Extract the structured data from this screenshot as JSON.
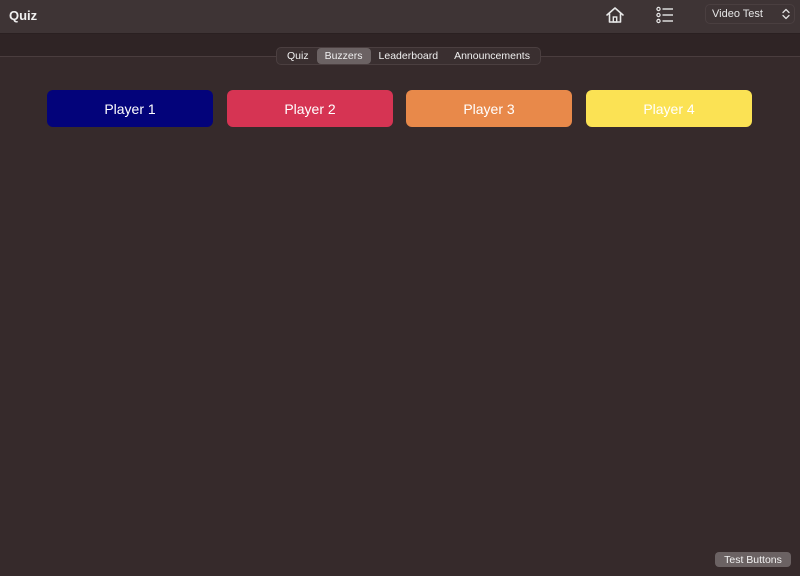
{
  "app": {
    "title": "Quiz"
  },
  "toolbar": {
    "home_icon": "home-icon",
    "list_icon": "list-icon",
    "select_value": "Video Test",
    "select_icon": "chevron-updown-icon"
  },
  "tabs": [
    {
      "label": "Quiz",
      "active": false
    },
    {
      "label": "Buzzers",
      "active": true
    },
    {
      "label": "Leaderboard",
      "active": false
    },
    {
      "label": "Announcements",
      "active": false
    }
  ],
  "players": [
    {
      "label": "Player 1",
      "color": "#03037a",
      "text_color": "#ffffff"
    },
    {
      "label": "Player 2",
      "color": "#d63453",
      "text_color": "#ffffff"
    },
    {
      "label": "Player 3",
      "color": "#e8894a",
      "text_color": "#ffffff"
    },
    {
      "label": "Player 4",
      "color": "#fbe254",
      "text_color": "#ffffff"
    }
  ],
  "footer": {
    "test_buttons_label": "Test Buttons"
  }
}
